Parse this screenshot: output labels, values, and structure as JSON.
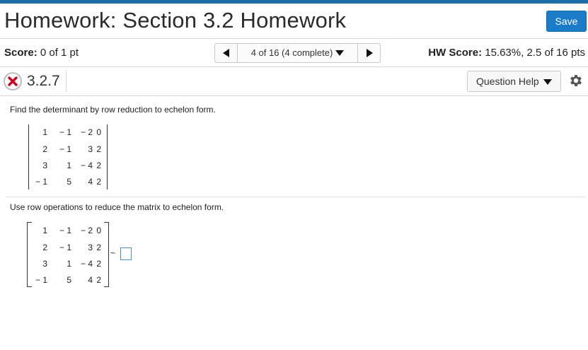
{
  "header": {
    "title": "Homework: Section 3.2 Homework",
    "save_label": "Save"
  },
  "score_bar": {
    "score_label": "Score:",
    "score_value": " 0 of 1 pt",
    "nav_label": "4 of 16 (4 complete)",
    "hw_score_label": "HW Score:",
    "hw_score_value": " 15.63%, 2.5 of 16 pts"
  },
  "question": {
    "status": "incorrect",
    "number": "3.2.7",
    "help_label": "Question Help",
    "prompt": "Find the determinant by row reduction to echelon form.",
    "matrix": [
      [
        "1",
        "− 1",
        "− 2",
        "0"
      ],
      [
        "2",
        "− 1",
        "3",
        "2"
      ],
      [
        "3",
        "1",
        "− 4",
        "2"
      ],
      [
        "− 1",
        "5",
        "4",
        "2"
      ]
    ],
    "step_prompt": "Use row operations to reduce the matrix to echelon form.",
    "tilde": "~",
    "answer_value": ""
  },
  "colors": {
    "accent": "#1a7cc9",
    "top_bar": "#1f6ea8",
    "error_red": "#d0021b"
  },
  "icons": {
    "status": "x-circle-icon",
    "prev": "triangle-left-icon",
    "next": "triangle-right-icon",
    "dropdown": "caret-down-icon",
    "settings": "gear-icon"
  }
}
